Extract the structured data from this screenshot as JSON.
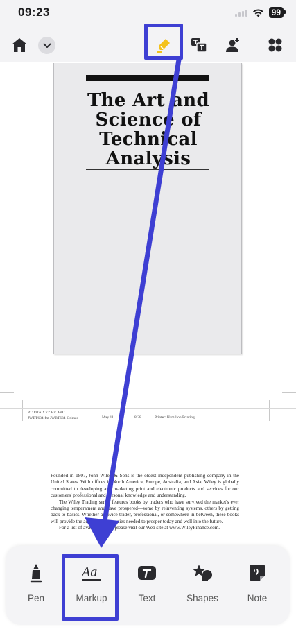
{
  "status_bar": {
    "time": "09:23",
    "battery": "99"
  },
  "toolbar": {
    "icons": [
      "home-icon",
      "chevron-down-icon",
      "highlighter-icon",
      "translate-icon",
      "person-plus-icon",
      "grid-icon"
    ]
  },
  "document": {
    "cover_title": "The Art and Science of Technical Analysis",
    "slug_line1": "P1: OTA/XYZ     P2: ABC",
    "slug_line2": "JWBT634-fm     JWBT634-Grimes",
    "slug_date": "May 11",
    "slug_time": "8:28",
    "slug_printer": "Printer: Hamilton Printing",
    "paragraph1": "Founded in 1807, John Wiley & Sons is the oldest independent publishing company in the United States. With offices in North America, Europe, Australia, and Asia, Wiley is globally committed to developing and marketing print and electronic products and services for our customers' professional and personal knowledge and understanding.",
    "paragraph2": "The Wiley Trading series features books by traders who have survived the market's ever changing temperament and have prospered—some by reinventing systems, others by getting back to basics. Whether a novice trader, professional, or somewhere in-between, these books will provide the advice and strategies needed to prosper today and well into the future.",
    "paragraph3": "For a list of available titles, please visit our Web site at www.WileyFinance.com."
  },
  "tools": {
    "pen": "Pen",
    "markup": "Markup",
    "text": "Text",
    "shapes": "Shapes",
    "note": "Note"
  },
  "colors": {
    "annotation": "#3e3fd3",
    "icon": "#2a2a2e"
  }
}
